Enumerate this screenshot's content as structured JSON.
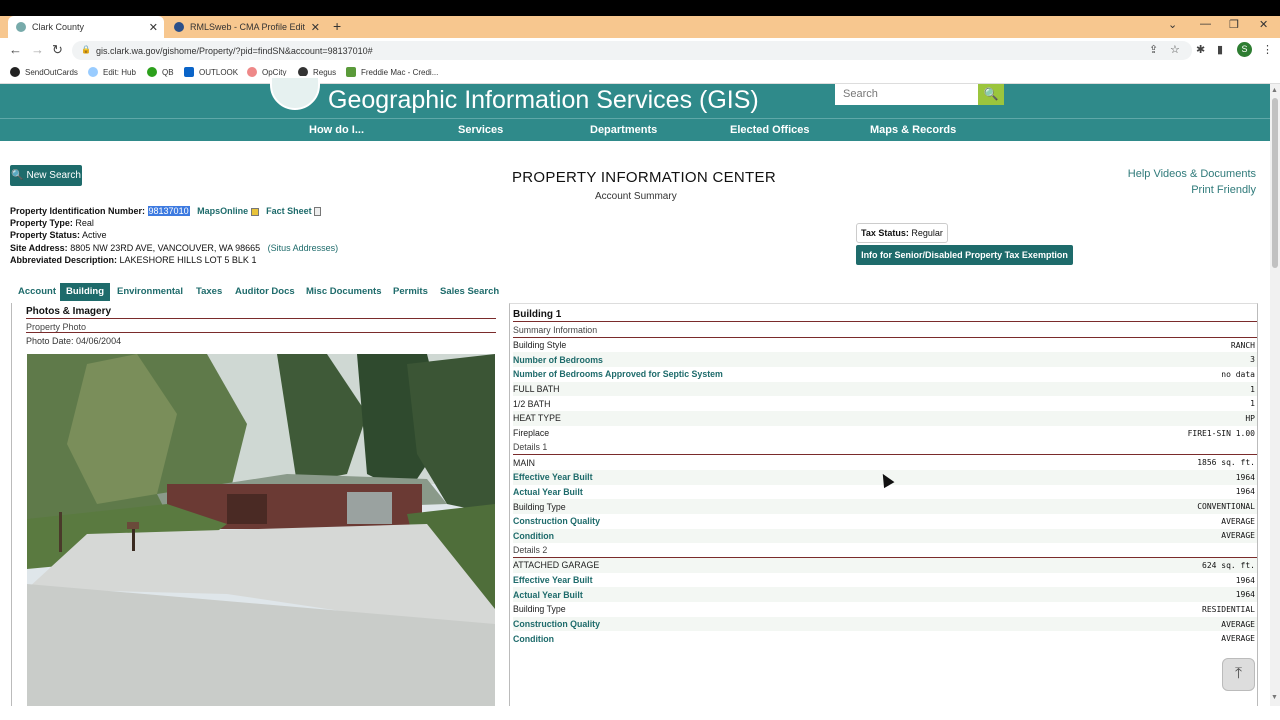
{
  "browser": {
    "tabs": [
      {
        "title": "Clark County",
        "active": true
      },
      {
        "title": "RMLSweb - CMA Profile Edit",
        "active": false
      }
    ],
    "url": "gis.clark.wa.gov/gishome/Property/?pid=findSN&account=98137010#",
    "bookmarks": [
      "SendOutCards",
      "Edit: Hub",
      "QB",
      "OUTLOOK",
      "OpCity",
      "Regus",
      "Freddie Mac - Credi..."
    ],
    "profile_initial": "S"
  },
  "gis": {
    "title": "Geographic Information Services (GIS)",
    "search_placeholder": "Search",
    "nav": [
      "How do I...",
      "Services",
      "Departments",
      "Elected Offices",
      "Maps & Records"
    ]
  },
  "page": {
    "new_search": "New Search",
    "title": "PROPERTY INFORMATION CENTER",
    "subtitle": "Account Summary",
    "help_link": "Help Videos & Documents",
    "print_link": "Print Friendly"
  },
  "property": {
    "pin_label": "Property Identification Number:",
    "pin": "98137010",
    "maps_online": "MapsOnline",
    "fact_sheet": "Fact Sheet",
    "type_label": "Property Type:",
    "type": "Real",
    "status_label": "Property Status:",
    "status": "Active",
    "address_label": "Site Address:",
    "address": "8805 NW 23RD AVE, VANCOUVER, WA 98665",
    "situs": "(Situs Addresses)",
    "desc_label": "Abbreviated Description:",
    "desc": "LAKESHORE HILLS LOT 5 BLK 1",
    "tax_status_label": "Tax Status:",
    "tax_status": "Regular",
    "senior_btn": "Info for Senior/Disabled Property Tax Exemption"
  },
  "tabs": [
    "Account",
    "Building",
    "Environmental",
    "Taxes",
    "Auditor Docs",
    "Misc Documents",
    "Permits",
    "Sales Search"
  ],
  "photos": {
    "header": "Photos & Imagery",
    "sub": "Property Photo",
    "date": "Photo Date: 04/06/2004"
  },
  "building": {
    "header": "Building 1",
    "rows": [
      {
        "label": "Summary Information",
        "value": "",
        "kind": "sub"
      },
      {
        "label": "Building Style",
        "value": "RANCH",
        "kind": "plain"
      },
      {
        "label": "Number of Bedrooms",
        "value": "3",
        "kind": "link"
      },
      {
        "label": "Number of Bedrooms Approved for Septic System",
        "value": "no data",
        "kind": "link"
      },
      {
        "label": "FULL BATH",
        "value": "1",
        "kind": "plain"
      },
      {
        "label": "1/2 BATH",
        "value": "1",
        "kind": "plain"
      },
      {
        "label": "HEAT TYPE",
        "value": "HP",
        "kind": "plain"
      },
      {
        "label": "Fireplace",
        "value": "FIRE1-SIN 1.00",
        "kind": "plain"
      },
      {
        "label": "Details 1",
        "value": "",
        "kind": "sub"
      },
      {
        "label": "MAIN",
        "value": "1856 sq. ft.",
        "kind": "plain"
      },
      {
        "label": "Effective Year Built",
        "value": "1964",
        "kind": "link"
      },
      {
        "label": "Actual Year Built",
        "value": "1964",
        "kind": "link"
      },
      {
        "label": "Building Type",
        "value": "CONVENTIONAL",
        "kind": "plain"
      },
      {
        "label": "Construction Quality",
        "value": "AVERAGE",
        "kind": "link"
      },
      {
        "label": "Condition",
        "value": "AVERAGE",
        "kind": "link"
      },
      {
        "label": "Details 2",
        "value": "",
        "kind": "sub"
      },
      {
        "label": "ATTACHED GARAGE",
        "value": "624 sq. ft.",
        "kind": "plain"
      },
      {
        "label": "Effective Year Built",
        "value": "1964",
        "kind": "link"
      },
      {
        "label": "Actual Year Built",
        "value": "1964",
        "kind": "link"
      },
      {
        "label": "Building Type",
        "value": "RESIDENTIAL",
        "kind": "plain"
      },
      {
        "label": "Construction Quality",
        "value": "AVERAGE",
        "kind": "link"
      },
      {
        "label": "Condition",
        "value": "AVERAGE",
        "kind": "link"
      }
    ]
  }
}
